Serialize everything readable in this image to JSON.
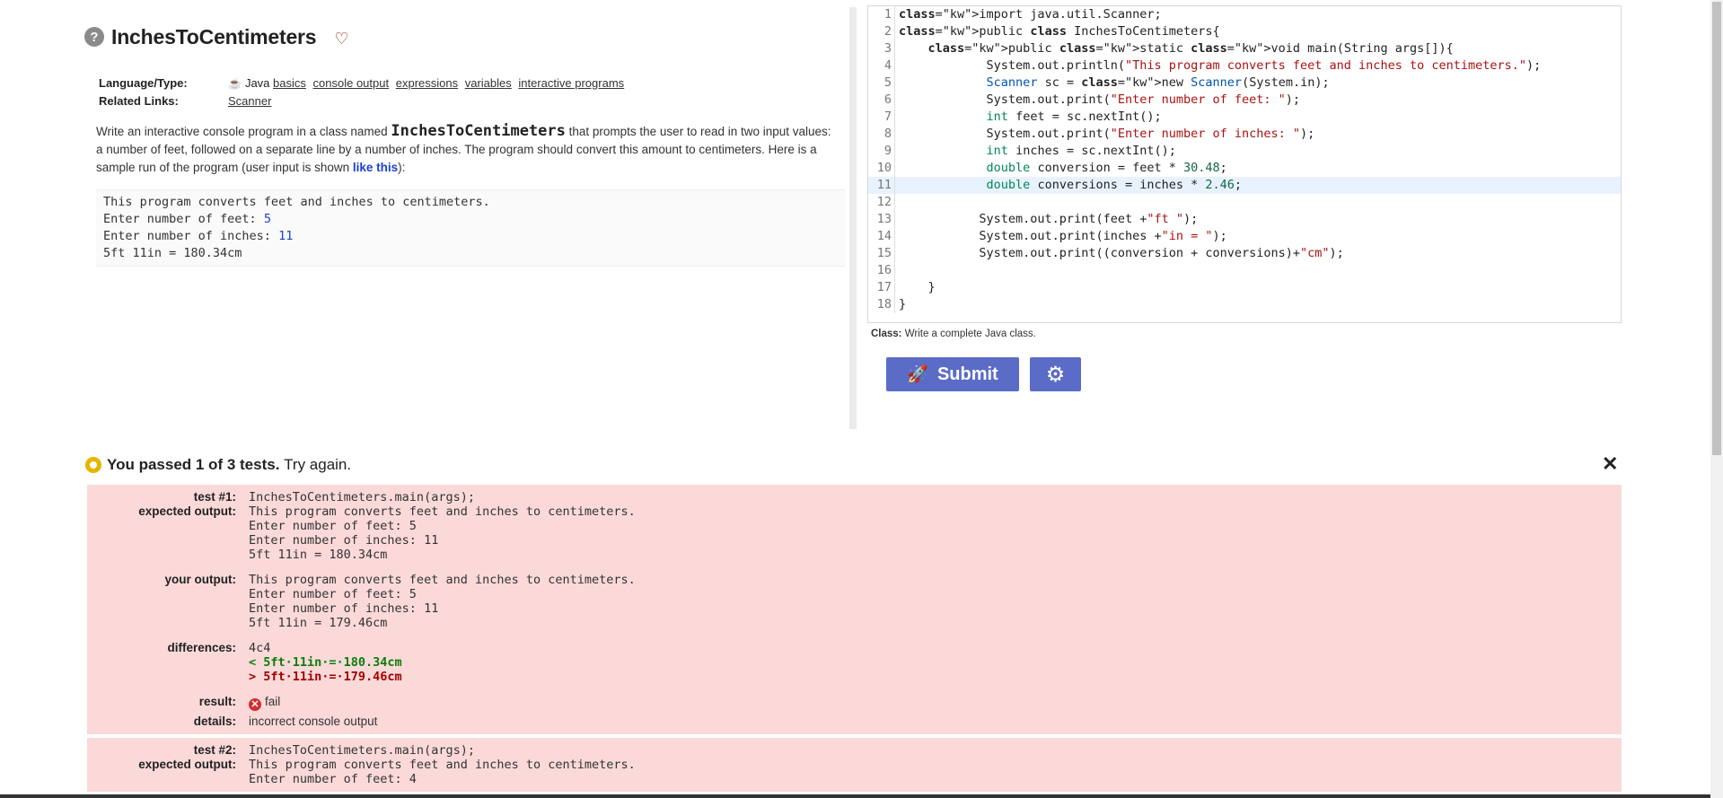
{
  "problem": {
    "title": "InchesToCentimeters",
    "language_label": "Language/Type:",
    "language_value": "Java",
    "topics": [
      "basics",
      "console output",
      "expressions",
      "variables",
      "interactive programs"
    ],
    "related_label": "Related Links:",
    "related_links": [
      "Scanner"
    ],
    "desc_part1": "Write an interactive console program in a class named ",
    "desc_class": "InchesToCentimeters",
    "desc_part2": " that prompts the user to read in two input values: a number of feet, followed on a separate line by a number of inches. The program should convert this amount to centimeters. Here is a sample run of the program (user input is shown ",
    "desc_like_this": "like this",
    "desc_part3": "):",
    "sample": [
      {
        "text": "This program converts feet and inches to centimeters.",
        "input": ""
      },
      {
        "text": "Enter number of feet: ",
        "input": "5"
      },
      {
        "text": "Enter number of inches: ",
        "input": "11"
      },
      {
        "text": "5ft 11in = 180.34cm",
        "input": ""
      }
    ]
  },
  "editor": {
    "highlighted_line": 11,
    "lines": [
      "import java.util.Scanner;",
      "public class InchesToCentimeters{",
      "    public static void main(String args[]){",
      "            System.out.println(\"This program converts feet and inches to centimeters.\");",
      "            Scanner sc = new Scanner(System.in);",
      "            System.out.print(\"Enter number of feet: \");",
      "            int feet = sc.nextInt();",
      "            System.out.print(\"Enter number of inches: \");",
      "            int inches = sc.nextInt();",
      "            double conversion = feet * 30.48;",
      "            double conversions = inches * 2.46;",
      "",
      "           System.out.print(feet +\"ft \");",
      "           System.out.print(inches +\"in = \");",
      "           System.out.print((conversion + conversions)+\"cm\");",
      "",
      "    }",
      "}"
    ]
  },
  "class_note_label": "Class:",
  "class_note_text": "Write a complete Java class.",
  "submit_label": "Submit",
  "results": {
    "summary_bold": "You passed 1 of 3 tests.",
    "summary_rest": "Try again.",
    "tests": [
      {
        "label": "test #1:",
        "call": "InchesToCentimeters.main(args);",
        "expected": "This program converts feet and inches to centimeters.\nEnter number of feet: 5\nEnter number of inches: 11\n5ft 11in = 180.34cm",
        "actual": "This program converts feet and inches to centimeters.\nEnter number of feet: 5\nEnter number of inches: 11\n5ft 11in = 179.46cm",
        "diff_header": "4c4",
        "diff_left": "< 5ft·11in·=·180.34cm",
        "diff_right": "> 5ft·11in·=·179.46cm",
        "result": "fail",
        "details": "incorrect console output"
      },
      {
        "label": "test #2:",
        "call": "InchesToCentimeters.main(args);",
        "expected": "This program converts feet and inches to centimeters.\nEnter number of feet: 4"
      }
    ],
    "labels": {
      "expected": "expected output:",
      "actual": "your output:",
      "diff": "differences:",
      "result": "result:",
      "details": "details:"
    }
  },
  "colors": {
    "accent_button": "#5b6cc6",
    "fail_bg": "#fbd9d9",
    "pass_icon": "#e5b600"
  }
}
